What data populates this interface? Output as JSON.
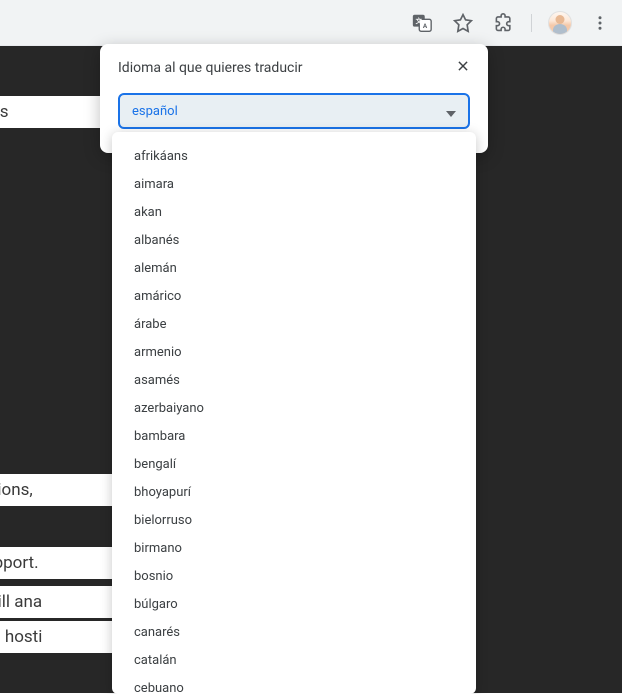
{
  "popup": {
    "title": "Idioma al que quieres traducir",
    "selected": "español"
  },
  "languages": [
    "afrikáans",
    "aimara",
    "akan",
    "albanés",
    "alemán",
    "amárico",
    "árabe",
    "armenio",
    "asamés",
    "azerbaiyano",
    "bambara",
    "bengalí",
    "bhoyapurí",
    "bielorruso",
    "birmano",
    "bosnio",
    "búlgaro",
    "canarés",
    "catalán",
    "cebuano"
  ],
  "background_text": {
    "t1": "s stories",
    "t2": "pe of options,",
    "t3": "s and support.",
    "t4": "sh. We will ana",
    "t5": "rfect web hosti"
  }
}
